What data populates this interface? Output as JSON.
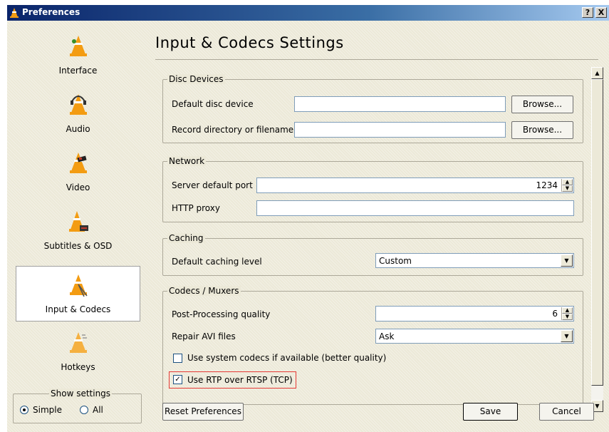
{
  "window": {
    "title": "Preferences",
    "help_btn": "?",
    "close_btn": "X"
  },
  "sidebar": {
    "items": [
      {
        "label": "Interface"
      },
      {
        "label": "Audio"
      },
      {
        "label": "Video"
      },
      {
        "label": "Subtitles & OSD"
      },
      {
        "label": "Input & Codecs",
        "selected": true
      },
      {
        "label": "Hotkeys"
      }
    ],
    "show_settings": {
      "legend": "Show settings",
      "simple": "Simple",
      "all": "All",
      "selected": "Simple"
    }
  },
  "page_title": "Input & Codecs Settings",
  "disc": {
    "legend": "Disc Devices",
    "default_device_label": "Default disc device",
    "default_device_value": "",
    "record_label": "Record directory or filename",
    "record_value": "",
    "browse1": "Browse...",
    "browse2": "Browse..."
  },
  "network": {
    "legend": "Network",
    "port_label": "Server default port",
    "port_value": "1234",
    "proxy_label": "HTTP proxy",
    "proxy_value": ""
  },
  "caching": {
    "legend": "Caching",
    "level_label": "Default caching level",
    "level_value": "Custom"
  },
  "codecs": {
    "legend": "Codecs / Muxers",
    "pp_label": "Post-Processing quality",
    "pp_value": "6",
    "avi_label": "Repair AVI files",
    "avi_value": "Ask",
    "syscodecs_label": "Use system codecs if available (better quality)",
    "syscodecs_checked": false,
    "rtp_label": "Use RTP over RTSP (TCP)",
    "rtp_checked": true,
    "highlight_color": "#e53935"
  },
  "buttons": {
    "reset": "Reset Preferences",
    "save": "Save",
    "cancel": "Cancel"
  },
  "colors": {
    "titlebar_start": "#0a246a",
    "titlebar_end": "#a6caf0",
    "cone_orange": "#f39c12"
  }
}
